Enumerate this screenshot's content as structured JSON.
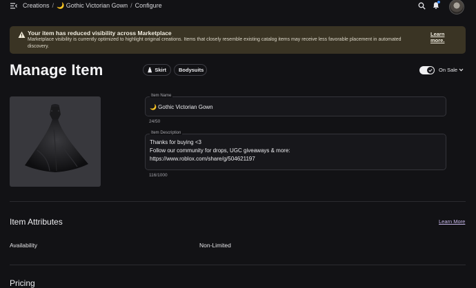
{
  "breadcrumb": {
    "root": "Creations",
    "item": "🌙 Gothic Victorian Gown",
    "current": "Configure"
  },
  "icons": {
    "menu": "menu-collapse-icon",
    "search": "search-icon",
    "notifications": "bell-icon",
    "warning": "warning-icon",
    "skirt": "skirt-icon",
    "chevron": "chevron-down-icon"
  },
  "banner": {
    "title": "Your item has reduced visibility across Marketplace",
    "body": "Marketplace visibility is currently optimized to highlight original creations. Items that closely resemble existing catalog items may receive less favorable placement in automated discovery.",
    "link": "Learn more."
  },
  "page": {
    "title": "Manage Item"
  },
  "tags": [
    "Skirt",
    "Bodysuits"
  ],
  "sale": {
    "label": "On Sale",
    "enabled": true
  },
  "form": {
    "name_label": "Item Name",
    "name_value": "🌙 Gothic Victorian Gown",
    "name_counter": "24/50",
    "desc_label": "Item Description",
    "desc_value": "Thanks for buying <3\nFollow our community for drops, UGC giveaways & more:\nhttps://www.roblox.com/share/g/504621197",
    "desc_counter": "116/1000"
  },
  "attributes": {
    "title": "Item Attributes",
    "learn_more": "Learn More",
    "availability_label": "Availability",
    "availability_value": "Non-Limited"
  },
  "pricing": {
    "title": "Pricing"
  },
  "colors": {
    "background": "#121215",
    "banner": "#3a3424",
    "link": "#c7b8ea",
    "notification_dot": "#3b8cff"
  }
}
